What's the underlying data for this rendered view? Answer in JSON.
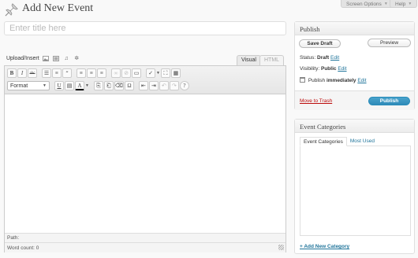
{
  "header": {
    "title": "Add New Event",
    "screen_options": "Screen Options",
    "help": "Help"
  },
  "title_field": {
    "placeholder": "Enter title here",
    "value": ""
  },
  "media": {
    "label": "Upload/Insert"
  },
  "editor": {
    "tabs": {
      "visual": "Visual",
      "html": "HTML"
    },
    "format_select": "Format",
    "path_label": "Path:",
    "word_count": "Word count: 0"
  },
  "publish": {
    "heading": "Publish",
    "save_draft": "Save Draft",
    "preview": "Preview",
    "status_label": "Status:",
    "status_value": "Draft",
    "visibility_label": "Visibility:",
    "visibility_value": "Public",
    "publish_label": "Publish",
    "publish_value": "immediately",
    "edit": "Edit",
    "trash": "Move to Trash",
    "publish_button": "Publish"
  },
  "categories": {
    "heading": "Event Categories",
    "tab_all": "Event Categories",
    "tab_most_used": "Most Used",
    "add_new": "+ Add New Category"
  },
  "colors": {
    "link": "#21759b",
    "trash": "#bc0b0b",
    "primary_button": "#2e8ab8"
  }
}
